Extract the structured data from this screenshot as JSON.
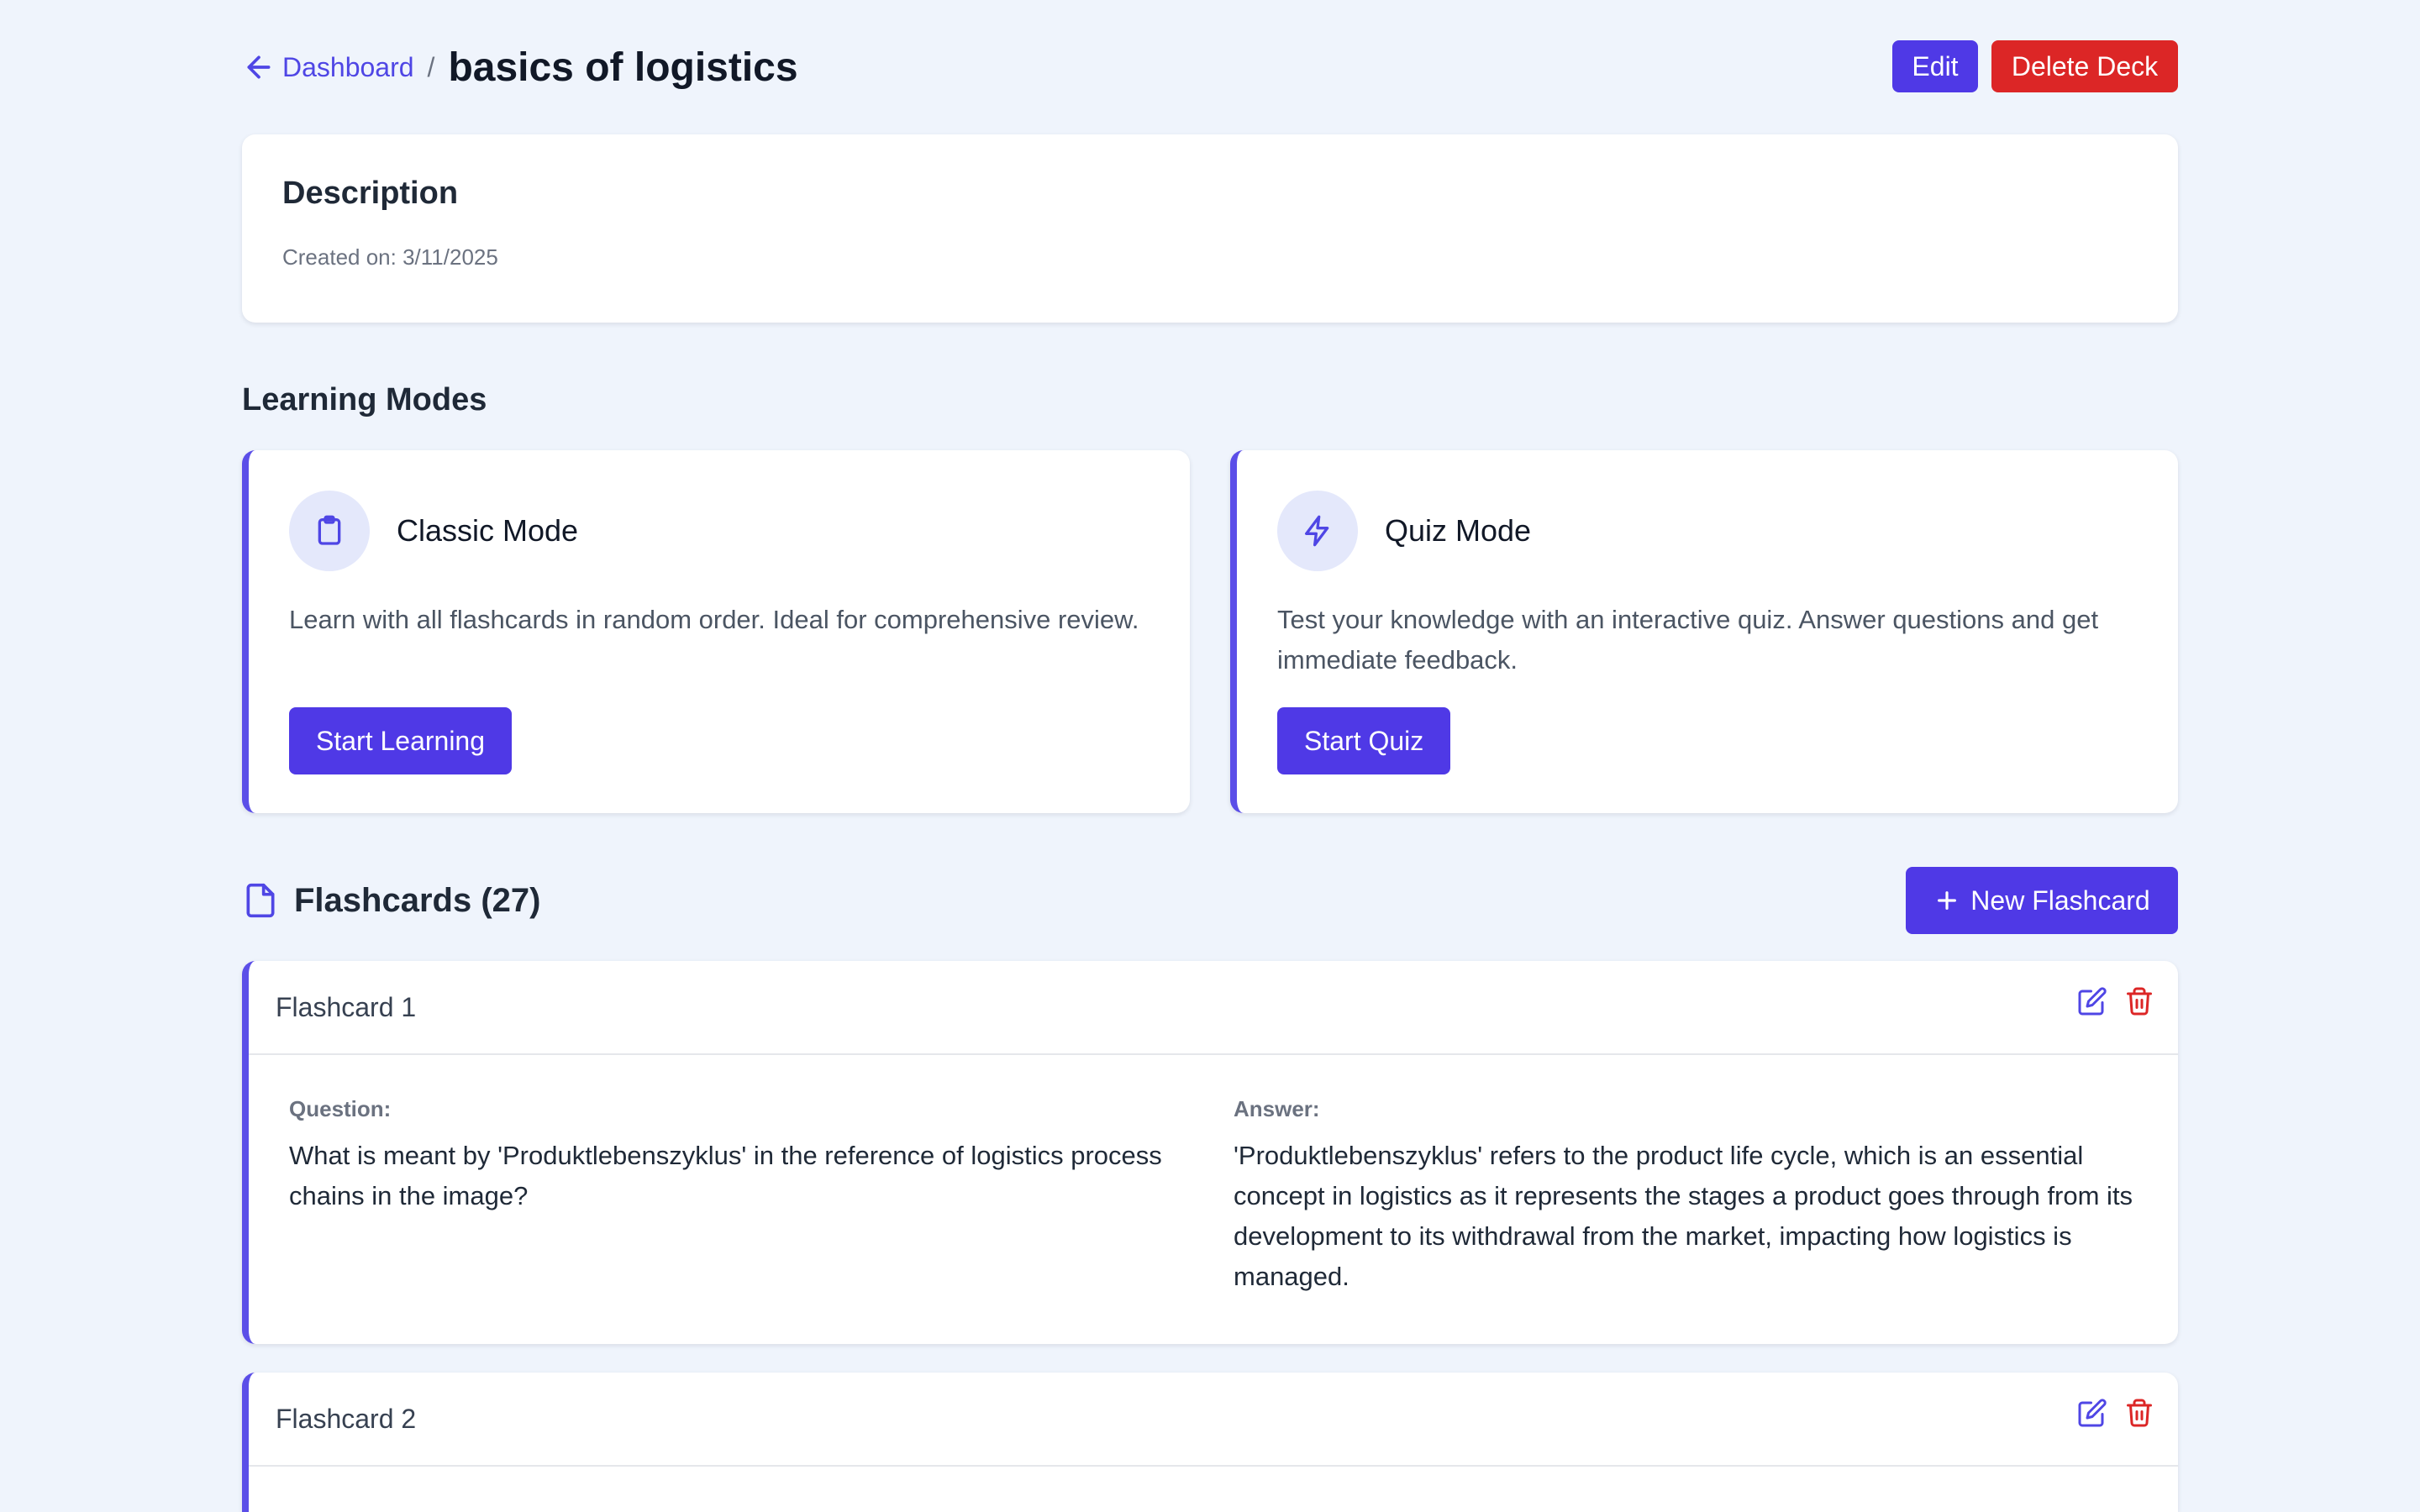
{
  "header": {
    "back_label": "Dashboard",
    "separator": "/",
    "title": "basics of logistics",
    "edit_label": "Edit",
    "delete_label": "Delete Deck"
  },
  "description": {
    "title": "Description",
    "created": "Created on: 3/11/2025"
  },
  "learning_modes": {
    "title": "Learning Modes",
    "modes": [
      {
        "name": "Classic Mode",
        "icon": "clipboard-icon",
        "description": "Learn with all flashcards in random order. Ideal for comprehensive review.",
        "button": "Start Learning"
      },
      {
        "name": "Quiz Mode",
        "icon": "lightning-icon",
        "description": "Test your knowledge with an interactive quiz. Answer questions and get immediate feedback.",
        "button": "Start Quiz"
      }
    ]
  },
  "flashcards": {
    "title": "Flashcards (27)",
    "icon": "document-icon",
    "new_label": "New Flashcard",
    "question_label": "Question:",
    "answer_label": "Answer:",
    "items": [
      {
        "name": "Flashcard 1",
        "question": "What is meant by 'Produktlebenszyklus' in the reference of logistics process chains in the image?",
        "answer": "'Produktlebenszyklus' refers to the product life cycle, which is an essential concept in logistics as it represents the stages a product goes through from its development to its withdrawal from the market, impacting how logistics is managed."
      },
      {
        "name": "Flashcard 2"
      }
    ]
  },
  "colors": {
    "background": "#eff4fc",
    "primary": "#4f39e6",
    "danger": "#dc2626",
    "accent_border": "#5b4ee8",
    "icon_circle": "#e4e8fb"
  }
}
